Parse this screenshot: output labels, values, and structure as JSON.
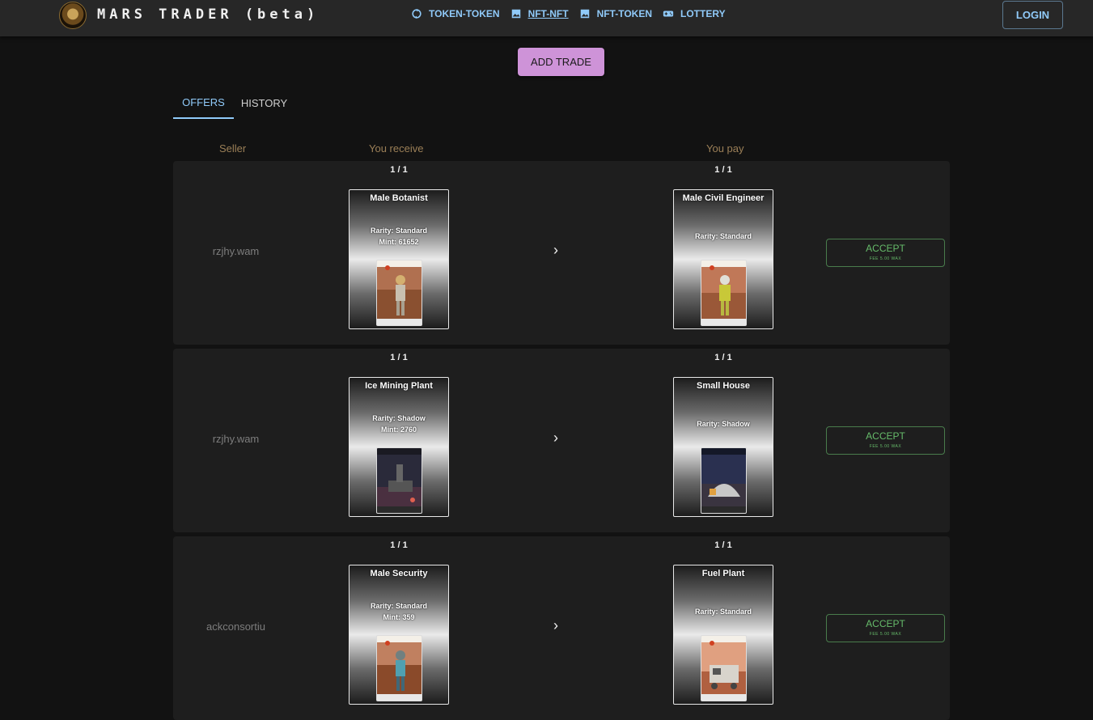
{
  "header": {
    "title": "MARS TRADER (beta)",
    "nav": [
      {
        "label": "TOKEN-TOKEN",
        "icon": "swap-icon"
      },
      {
        "label": "NFT-NFT",
        "icon": "image-icon"
      },
      {
        "label": "NFT-TOKEN",
        "icon": "image-icon"
      },
      {
        "label": "LOTTERY",
        "icon": "gamepad-icon"
      }
    ],
    "login_label": "LOGIN"
  },
  "add_trade_label": "ADD TRADE",
  "tabs": [
    {
      "label": "OFFERS"
    },
    {
      "label": "HISTORY"
    }
  ],
  "columns": {
    "seller": "Seller",
    "receive": "You receive",
    "pay": "You pay"
  },
  "offers": [
    {
      "seller": "rzjhy.wam",
      "receive_count": "1 / 1",
      "pay_count": "1 / 1",
      "receive": {
        "name": "Male Botanist",
        "rarity": "Rarity: Standard",
        "mint": "Mint: 61652"
      },
      "pay": {
        "name": "Male Civil Engineer",
        "rarity": "Rarity: Standard"
      },
      "accept": "ACCEPT",
      "fee": "FEE 5.00 WAX"
    },
    {
      "seller": "rzjhy.wam",
      "receive_count": "1 / 1",
      "pay_count": "1 / 1",
      "receive": {
        "name": "Ice Mining Plant",
        "rarity": "Rarity: Shadow",
        "mint": "Mint: 2760"
      },
      "pay": {
        "name": "Small House",
        "rarity": "Rarity: Shadow"
      },
      "accept": "ACCEPT",
      "fee": "FEE 5.00 WAX"
    },
    {
      "seller": "ackconsortiu",
      "receive_count": "1 / 1",
      "pay_count": "1 / 1",
      "receive": {
        "name": "Male Security",
        "rarity": "Rarity: Standard",
        "mint": "Mint: 359"
      },
      "pay": {
        "name": "Fuel Plant",
        "rarity": "Rarity: Standard"
      },
      "accept": "ACCEPT",
      "fee": "FEE 5.00 WAX"
    }
  ],
  "colors": {
    "accent": "#90caf9",
    "add_trade": "#ce93d8",
    "accept": "#66bb6a",
    "column_head": "#9b7f57"
  }
}
